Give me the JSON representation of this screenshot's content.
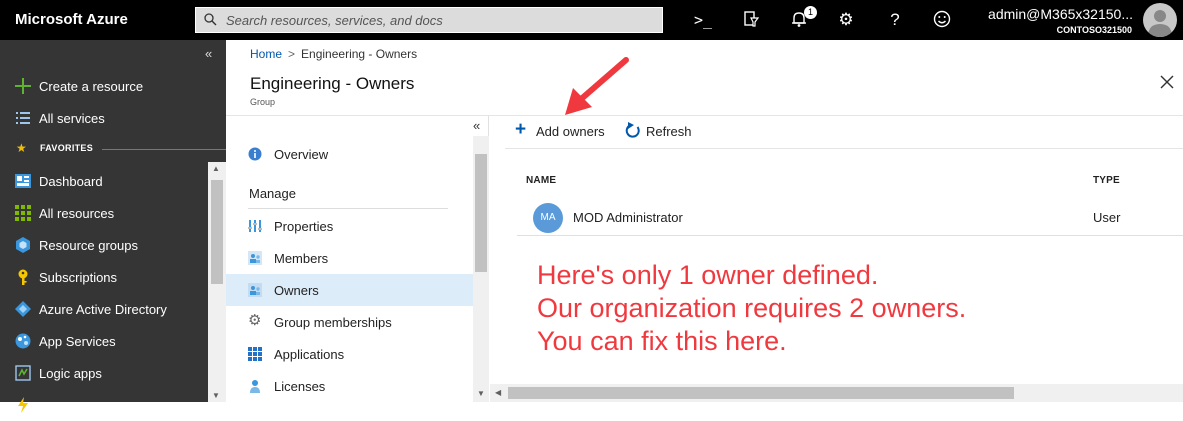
{
  "topbar": {
    "brand": "Microsoft Azure",
    "search_placeholder": "Search resources, services, and docs",
    "notification_count": "1",
    "account_name": "admin@M365x32150...",
    "account_tenant": "CONTOSO321500",
    "icons": [
      "cloud-shell-icon",
      "directory-filter-icon",
      "notifications-icon",
      "settings-icon",
      "help-icon",
      "feedback-smiley-icon"
    ]
  },
  "leftnav": {
    "collapse_glyph": "«",
    "create_resource": "Create a resource",
    "all_services": "All services",
    "favorites_label": "FAVORITES",
    "items": [
      {
        "label": "Dashboard",
        "icon": "dashboard-icon"
      },
      {
        "label": "All resources",
        "icon": "all-resources-icon"
      },
      {
        "label": "Resource groups",
        "icon": "resource-groups-icon"
      },
      {
        "label": "Subscriptions",
        "icon": "subscriptions-key-icon"
      },
      {
        "label": "Azure Active Directory",
        "icon": "azure-ad-icon"
      },
      {
        "label": "App Services",
        "icon": "app-services-icon"
      },
      {
        "label": "Logic apps",
        "icon": "logic-apps-icon"
      }
    ]
  },
  "blade": {
    "breadcrumb_home": "Home",
    "breadcrumb_current": "Engineering - Owners",
    "title": "Engineering - Owners",
    "subtitle": "Group"
  },
  "menu": {
    "overview": "Overview",
    "section_manage": "Manage",
    "items": [
      {
        "label": "Properties",
        "icon": "properties-icon",
        "selected": false
      },
      {
        "label": "Members",
        "icon": "members-icon",
        "selected": false
      },
      {
        "label": "Owners",
        "icon": "owners-icon",
        "selected": true
      },
      {
        "label": "Group memberships",
        "icon": "gear-icon",
        "selected": false
      },
      {
        "label": "Applications",
        "icon": "applications-icon",
        "selected": false
      },
      {
        "label": "Licenses",
        "icon": "licenses-icon",
        "selected": false
      }
    ]
  },
  "toolbar": {
    "add_owners": "Add owners",
    "refresh": "Refresh"
  },
  "table": {
    "columns": [
      "NAME",
      "TYPE"
    ],
    "rows": [
      {
        "initials": "MA",
        "name": "MOD Administrator",
        "type": "User"
      }
    ]
  },
  "annotation": {
    "lines": [
      "Here's only 1 owner defined.",
      "Our organization requires 2 owners.",
      "You can fix this here."
    ],
    "color": "#f0393f"
  },
  "colors": {
    "accent": "#0058ad",
    "nav_bg": "#353535",
    "topbar_bg": "#000000",
    "selected_bg": "#dcecf9"
  }
}
